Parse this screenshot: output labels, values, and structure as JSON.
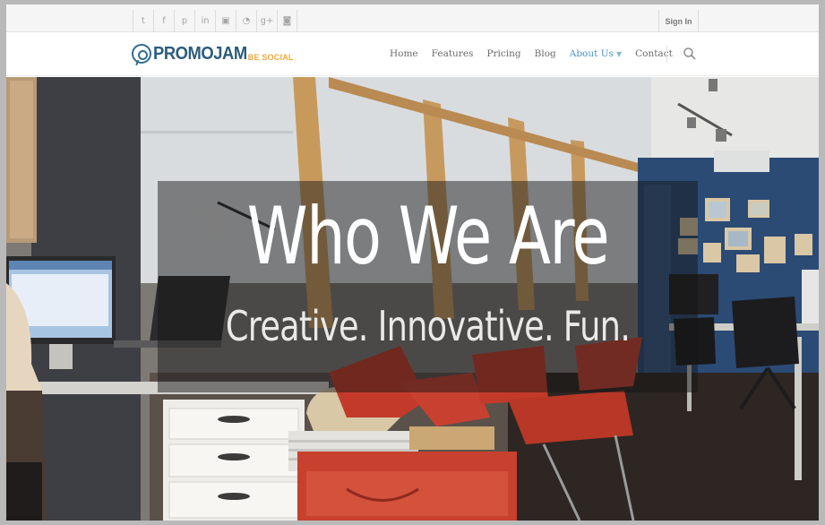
{
  "social_icons": [
    {
      "name": "twitter-icon",
      "glyph": "t"
    },
    {
      "name": "facebook-icon",
      "glyph": "f"
    },
    {
      "name": "pinterest-icon",
      "glyph": "p"
    },
    {
      "name": "linkedin-icon",
      "glyph": "in"
    },
    {
      "name": "youtube-icon",
      "glyph": "▣"
    },
    {
      "name": "rss-icon",
      "glyph": "◔"
    },
    {
      "name": "google-plus-icon",
      "glyph": "g+"
    },
    {
      "name": "instagram-icon",
      "glyph": "◙"
    }
  ],
  "topbar": {
    "sign_in": "Sign In"
  },
  "logo": {
    "text": "PROMOJAM",
    "sub": "BE SOCIAL"
  },
  "nav": {
    "items": [
      "Home",
      "Features",
      "Pricing",
      "Blog",
      "About Us",
      "Contact"
    ],
    "active": "About Us"
  },
  "hero": {
    "title": "Who We Are",
    "tagline": "Creative. Innovative. Fun."
  },
  "colors": {
    "accent": "#4a90c6",
    "logo_blue": "#2c5c7a",
    "logo_orange": "#f1a93b",
    "wall_blue": "#2b4b75",
    "chair_red": "#c8402e"
  }
}
